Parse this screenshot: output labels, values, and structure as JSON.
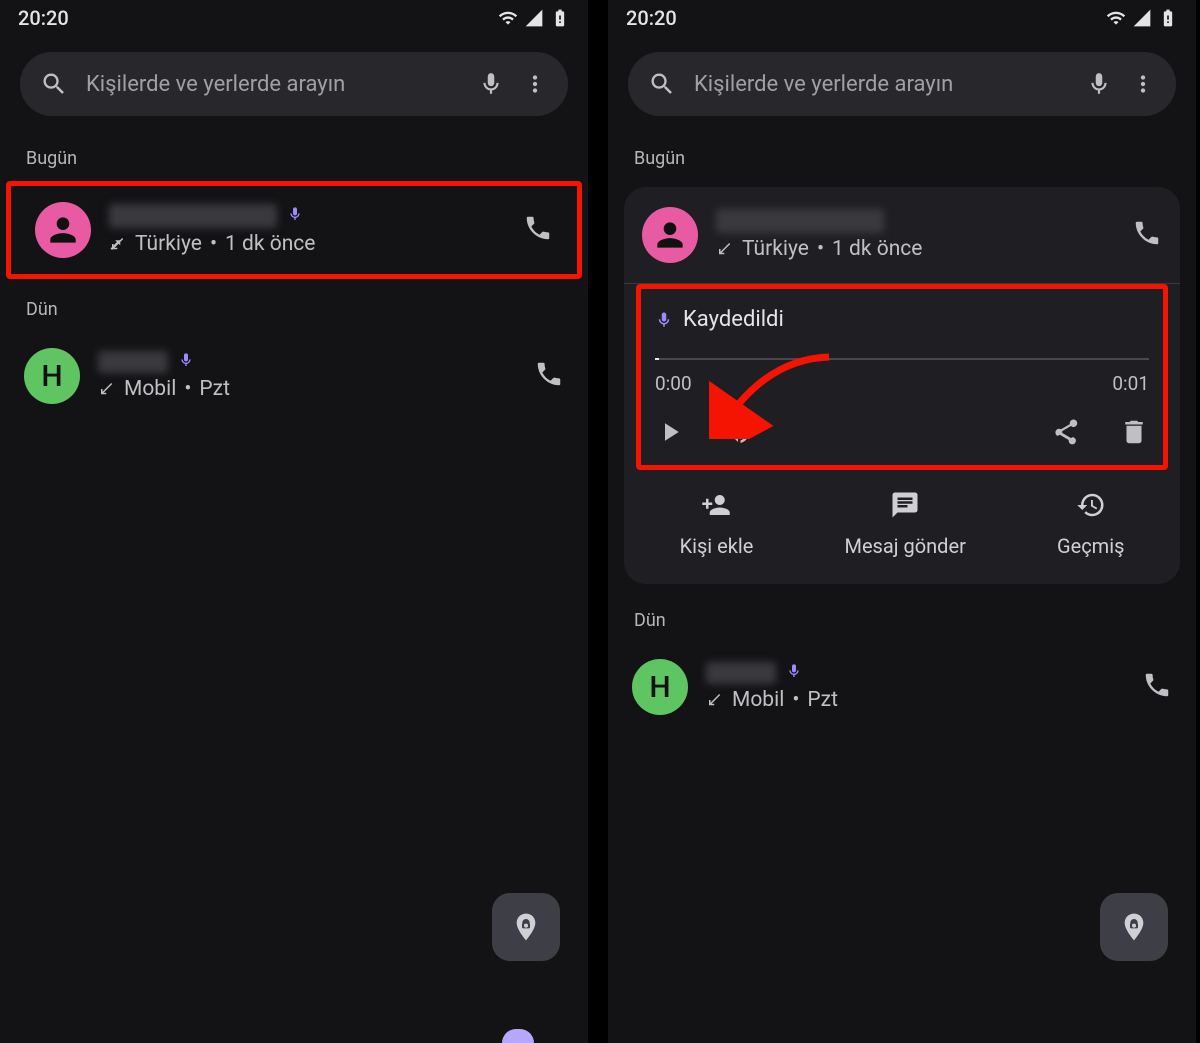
{
  "status": {
    "time": "20:20"
  },
  "search": {
    "placeholder": "Kişilerde ve yerlerde arayın"
  },
  "sections": {
    "today": "Bugün",
    "yesterday": "Dün"
  },
  "calls": {
    "pink": {
      "location": "Türkiye",
      "sep": "•",
      "ago": "1 dk önce",
      "avatar_letter": ""
    },
    "green": {
      "avatar_letter": "H",
      "type": "Mobil",
      "sep": "•",
      "day": "Pzt"
    }
  },
  "recording": {
    "title": "Kaydedildi",
    "start": "0:00",
    "end": "0:01"
  },
  "actions": {
    "add": "Kişi ekle",
    "message": "Mesaj gönder",
    "history": "Geçmiş"
  }
}
